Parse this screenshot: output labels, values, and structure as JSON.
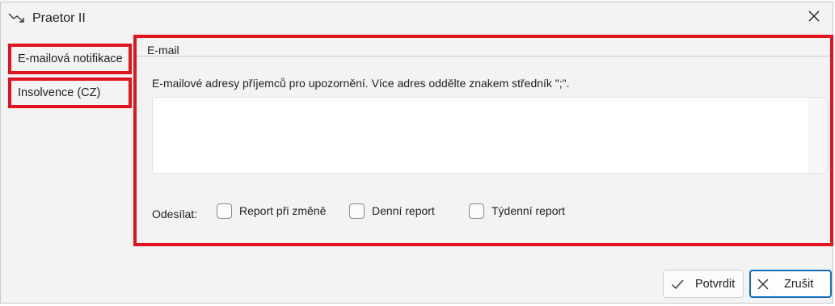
{
  "window": {
    "title": "Praetor II",
    "icons": {
      "app": "trend-down-arrow-icon",
      "close": "close-icon"
    }
  },
  "nav": {
    "items": [
      {
        "label": "E-mailová notifikace"
      },
      {
        "label": "Insolvence (CZ)"
      }
    ]
  },
  "email": {
    "group_title": "E-mail",
    "description": "E-mailové adresy příjemců pro upozornění. Více adres oddělte znakem středník \";\".",
    "recipients_value": "",
    "send_label": "Odesílat:",
    "options": [
      {
        "label": "Report při změně",
        "checked": false
      },
      {
        "label": "Denní report",
        "checked": false
      },
      {
        "label": "Týdenní report",
        "checked": false
      }
    ]
  },
  "footer": {
    "confirm_label": "Potvrdit",
    "cancel_label": "Zrušit",
    "icons": {
      "confirm": "checkmark-icon",
      "cancel": "close-icon"
    }
  },
  "colors": {
    "highlight": "#e0131f",
    "accent": "#0f6cbd",
    "window_bg": "#f3f3f3"
  }
}
